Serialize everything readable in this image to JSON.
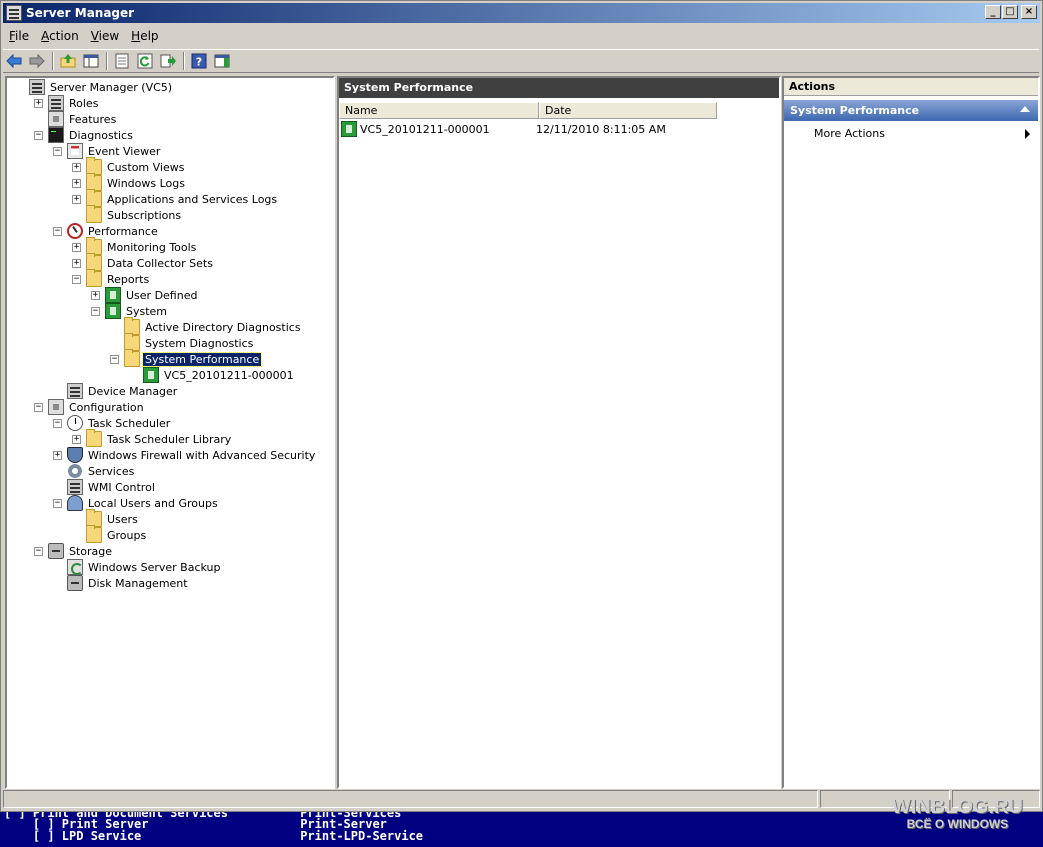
{
  "window": {
    "title": "Server Manager"
  },
  "window_buttons": {
    "minimize": "_",
    "maximize": "□",
    "close": "×"
  },
  "menu": [
    {
      "label": "File",
      "accel": "F",
      "rest": "ile"
    },
    {
      "label": "Action",
      "accel": "A",
      "rest": "ction"
    },
    {
      "label": "View",
      "accel": "V",
      "rest": "iew"
    },
    {
      "label": "Help",
      "accel": "H",
      "rest": "elp"
    }
  ],
  "toolbar_icons": [
    "back-arrow-icon",
    "forward-arrow-icon",
    "up-folder-icon",
    "show-hide-tree-icon",
    "properties-icon",
    "refresh-icon",
    "export-list-icon",
    "help-icon",
    "show-action-pane-icon"
  ],
  "tree": {
    "items": [
      {
        "label": "Server Manager (VC5)",
        "icon": "server-icon",
        "expander": ""
      },
      {
        "label": "Roles",
        "icon": "roles-icon",
        "expander": "+"
      },
      {
        "label": "Features",
        "icon": "features-icon",
        "expander": ""
      },
      {
        "label": "Diagnostics",
        "icon": "diagnostics-icon",
        "expander": "−"
      },
      {
        "label": "Event Viewer",
        "icon": "event-viewer-icon",
        "expander": "−"
      },
      {
        "label": "Custom Views",
        "icon": "folder-icon",
        "expander": "+"
      },
      {
        "label": "Windows Logs",
        "icon": "folder-icon",
        "expander": "+"
      },
      {
        "label": "Applications and Services Logs",
        "icon": "folder-icon",
        "expander": "+"
      },
      {
        "label": "Subscriptions",
        "icon": "folder-icon",
        "expander": ""
      },
      {
        "label": "Performance",
        "icon": "performance-icon",
        "expander": "−"
      },
      {
        "label": "Monitoring Tools",
        "icon": "folder-icon",
        "expander": "+"
      },
      {
        "label": "Data Collector Sets",
        "icon": "folder-icon",
        "expander": "+"
      },
      {
        "label": "Reports",
        "icon": "report-folder-icon",
        "expander": "−"
      },
      {
        "label": "User Defined",
        "icon": "report-icon",
        "expander": "+"
      },
      {
        "label": "System",
        "icon": "report-icon",
        "expander": "−"
      },
      {
        "label": "Active Directory Diagnostics",
        "icon": "report-folder-icon",
        "expander": ""
      },
      {
        "label": "System Diagnostics",
        "icon": "report-folder-icon",
        "expander": ""
      },
      {
        "label": "System Performance",
        "icon": "report-folder-icon",
        "expander": "−"
      },
      {
        "label": "VC5_20101211-000001",
        "icon": "report-icon",
        "expander": ""
      },
      {
        "label": "Device Manager",
        "icon": "device-manager-icon",
        "expander": ""
      },
      {
        "label": "Configuration",
        "icon": "configuration-icon",
        "expander": "−"
      },
      {
        "label": "Task Scheduler",
        "icon": "clock-icon",
        "expander": "−"
      },
      {
        "label": "Task Scheduler Library",
        "icon": "folder-icon",
        "expander": "+"
      },
      {
        "label": "Windows Firewall with Advanced Security",
        "icon": "firewall-icon",
        "expander": "+"
      },
      {
        "label": "Services",
        "icon": "services-icon",
        "expander": ""
      },
      {
        "label": "WMI Control",
        "icon": "wmi-icon",
        "expander": ""
      },
      {
        "label": "Local Users and Groups",
        "icon": "users-icon",
        "expander": "−"
      },
      {
        "label": "Users",
        "icon": "folder-icon",
        "expander": ""
      },
      {
        "label": "Groups",
        "icon": "folder-icon",
        "expander": ""
      },
      {
        "label": "Storage",
        "icon": "storage-icon",
        "expander": "−"
      },
      {
        "label": "Windows Server Backup",
        "icon": "backup-icon",
        "expander": ""
      },
      {
        "label": "Disk Management",
        "icon": "disk-icon",
        "expander": ""
      }
    ]
  },
  "center": {
    "title": "System Performance",
    "columns": [
      "Name",
      "Date"
    ],
    "rows": [
      {
        "name": "VC5_20101211-000001",
        "date": "12/11/2010 8:11:05 AM"
      }
    ]
  },
  "actions": {
    "title": "Actions",
    "section": "System Performance",
    "items": [
      {
        "label": "More Actions"
      }
    ]
  },
  "console": {
    "lines": [
      "[ ] Print and Document Services          Print-Services",
      "    [ ] Print Server                     Print-Server",
      "    [ ] LPD Service                      Print-LPD-Service"
    ]
  },
  "watermark": {
    "line1": "WINBLOG.RU",
    "line2": "ВСЁ О WINDOWS"
  }
}
